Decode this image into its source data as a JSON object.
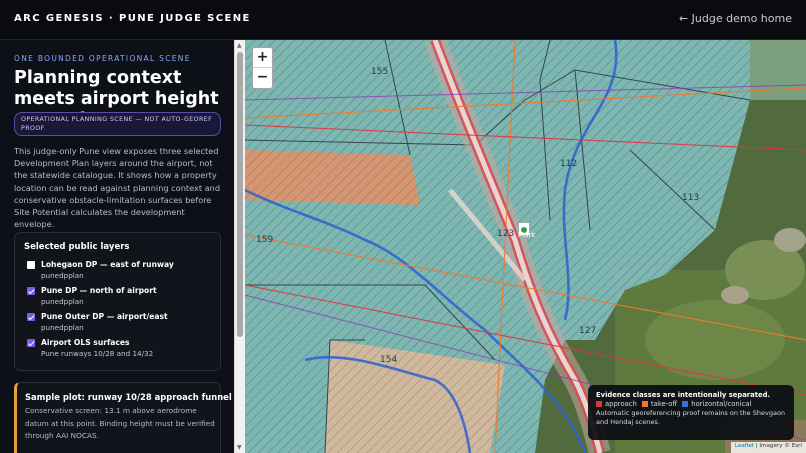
{
  "header": {
    "brand": "ARC GENESIS · PUNE JUDGE SCENE",
    "back_link": "← Judge demo home"
  },
  "sidebar": {
    "eyebrow": "ONE BOUNDED OPERATIONAL SCENE",
    "title": "Planning context meets airport height screening",
    "pill": "OPERATIONAL PLANNING SCENE — NOT AUTO-GEOREF PROOF",
    "intro": "This judge-only Pune view exposes three selected Development Plan layers around the airport, not the statewide catalogue. It shows how a property location can be read against planning context and conservative obstacle-limitation surfaces before Site Potential calculates the development envelope.",
    "layers": {
      "title": "Selected public layers",
      "items": [
        {
          "name": "Lohegaon DP — east of runway",
          "sub": "punedpplan",
          "checked": false
        },
        {
          "name": "Pune DP — north of airport",
          "sub": "punedpplan",
          "checked": true
        },
        {
          "name": "Pune Outer DP — airport/east",
          "sub": "punedpplan",
          "checked": true
        },
        {
          "name": "Airport OLS surfaces",
          "sub": "Pune runways 10/28 and 14/32",
          "checked": true
        }
      ]
    },
    "plot": {
      "title": "Sample plot: runway 10/28 approach funnel",
      "text": "Conservative screen: 13.1 m above aerodrome datum at this point. Binding height must be verified through AAI NOCAS."
    }
  },
  "map": {
    "zoom_in": "+",
    "zoom_out": "−",
    "plot_labels": [
      "155",
      "112",
      "113",
      "159",
      "123",
      "127",
      "154"
    ],
    "marker_label": "Mark",
    "legend": {
      "title": "Evidence classes are intentionally separated.",
      "approach": "approach",
      "takeoff": "take-off",
      "horizontal": "horizontal/conical",
      "note": "Automatic georeferencing proof remains on the Shevgaon and Hendaj scenes.",
      "colors": {
        "approach": "#e0343c",
        "takeoff": "#f07a2a",
        "horizontal": "#3a6fe0"
      }
    },
    "attribution": {
      "leaflet": "Leaflet",
      "rest": " | Imagery © Esri"
    }
  }
}
